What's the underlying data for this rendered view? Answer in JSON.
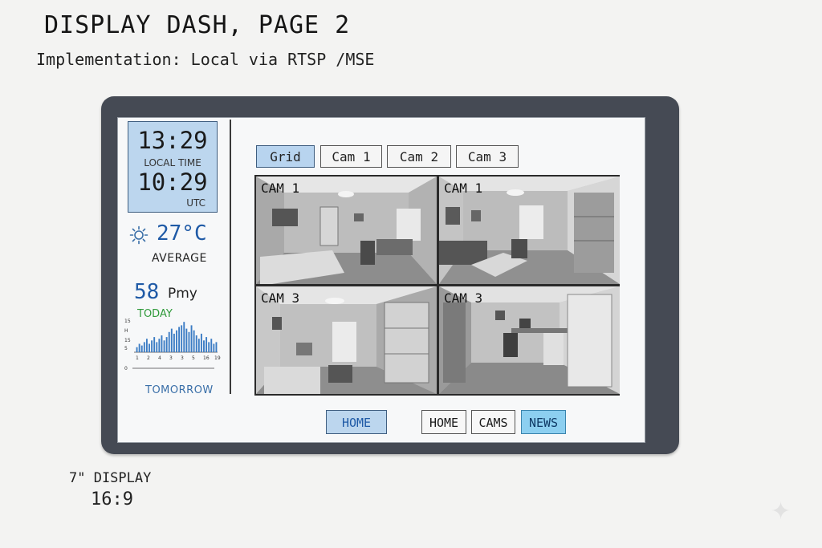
{
  "sketch": {
    "title": "DISPLAY  DASH,  PAGE 2",
    "subtitle": "Implementation:  Local via RTSP /MSE",
    "display_size": "7\" DISPLAY",
    "aspect": "16:9"
  },
  "clock": {
    "local_time": "13:29",
    "local_label": "LOCAL  TIME",
    "utc_time": "10:29",
    "utc_label": "UTC"
  },
  "weather": {
    "icon": "sun-icon",
    "temperature": "27°C",
    "label": "AVERAGE"
  },
  "pm": {
    "value": "58",
    "unit": "Pmy",
    "today_label": "TODAY",
    "tomorrow_label": "TOMORROW"
  },
  "tabs": [
    {
      "label": "Grid",
      "active": true
    },
    {
      "label": "Cam 1",
      "active": false
    },
    {
      "label": "Cam 2",
      "active": false
    },
    {
      "label": "Cam 3",
      "active": false
    }
  ],
  "cameras": [
    {
      "label": "CAM 1"
    },
    {
      "label": "CAM 1"
    },
    {
      "label": "CAM 3"
    },
    {
      "label": "CAM 3"
    }
  ],
  "nav": {
    "home_primary": "HOME",
    "home": "HOME",
    "cams": "CAMS",
    "news": "NEWS"
  },
  "colors": {
    "accent_blue": "#1f5aa6",
    "panel_blue": "#bcd6ee",
    "news_blue": "#8ccff0",
    "today_green": "#2f9a3a"
  },
  "chart_data": {
    "type": "bar",
    "title": "",
    "ylabel": "",
    "xlabel": "",
    "yticks": [
      "15",
      "H",
      "15",
      "5"
    ],
    "bottom_tick": "0",
    "xticks": [
      "1",
      "2",
      "4",
      "3",
      "3",
      "5",
      "16",
      "19"
    ],
    "values": [
      3,
      5,
      4,
      6,
      8,
      5,
      7,
      9,
      6,
      8,
      10,
      7,
      9,
      12,
      14,
      11,
      13,
      15,
      16,
      18,
      14,
      12,
      16,
      13,
      10,
      8,
      11,
      7,
      9,
      6,
      8,
      5,
      6
    ],
    "ylim": [
      0,
      20
    ]
  }
}
